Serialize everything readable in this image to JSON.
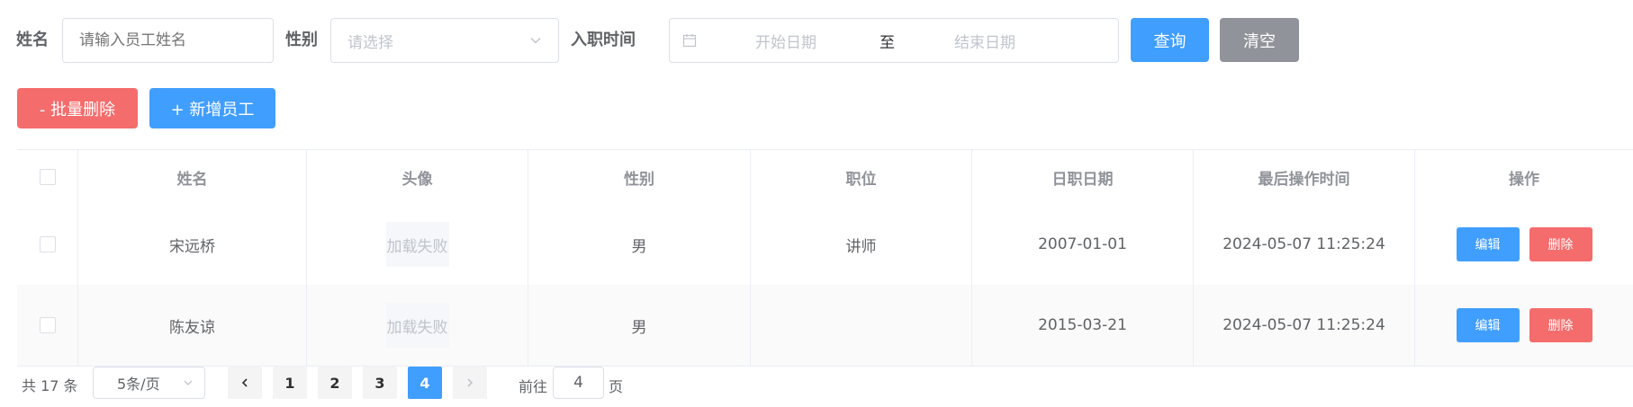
{
  "search": {
    "name_label": "姓名",
    "name_placeholder": "请输入员工姓名",
    "gender_label": "性别",
    "gender_placeholder": "请选择",
    "date_label": "入职时间",
    "start_placeholder": "开始日期",
    "range_separator": "至",
    "end_placeholder": "结束日期",
    "query_button": "查询",
    "clear_button": "清空"
  },
  "actions": {
    "batch_delete": "- 批量删除",
    "add_employee": "+ 新增员工"
  },
  "table": {
    "headers": {
      "name": "姓名",
      "avatar": "头像",
      "gender": "性别",
      "position": "职位",
      "entry_date": "日职日期",
      "last_op_time": "最后操作时间",
      "operation": "操作"
    },
    "rows": [
      {
        "name": "宋远桥",
        "avatar": "加载失败",
        "gender": "男",
        "position": "讲师",
        "entry_date": "2007-01-01",
        "last_op_time": "2024-05-07 11:25:24",
        "edit": "编辑",
        "delete": "删除"
      },
      {
        "name": "陈友谅",
        "avatar": "加载失败",
        "gender": "男",
        "position": "",
        "entry_date": "2015-03-21",
        "last_op_time": "2024-05-07 11:25:24",
        "edit": "编辑",
        "delete": "删除"
      }
    ]
  },
  "pagination": {
    "total_text": "共 17 条",
    "page_size": "5条/页",
    "pages": [
      "1",
      "2",
      "3",
      "4"
    ],
    "current_page": "4",
    "goto_prefix": "前往",
    "goto_value": "4",
    "goto_suffix": "页"
  },
  "colors": {
    "primary": "#409eff",
    "danger": "#f56c6c",
    "info": "#909399"
  }
}
